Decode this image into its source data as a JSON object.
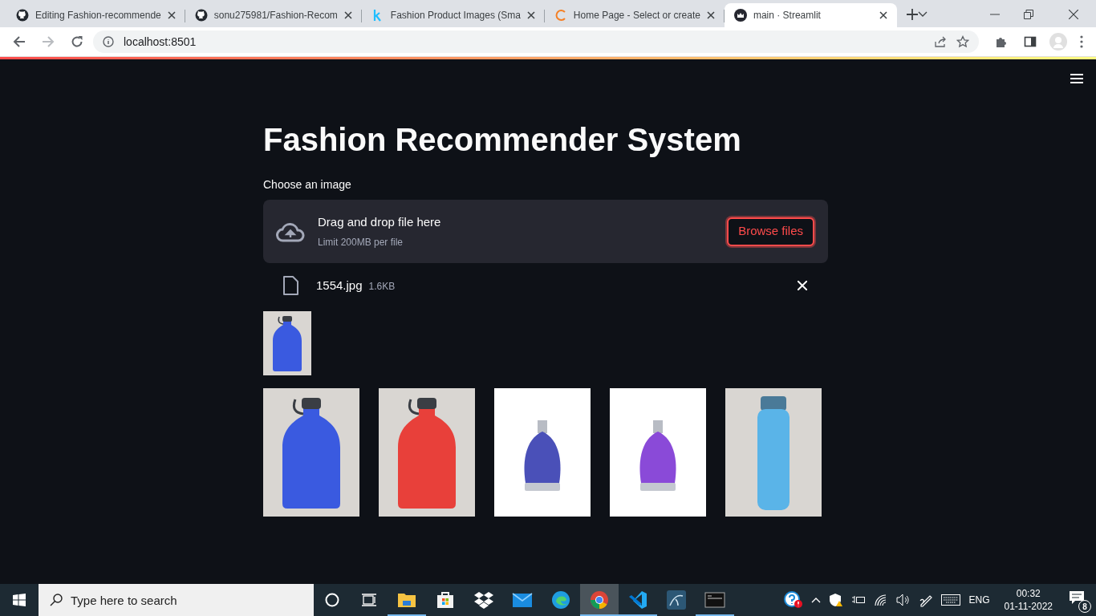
{
  "browser": {
    "tabs": [
      {
        "title": "Editing Fashion-recommende",
        "kind": "github",
        "selected": false
      },
      {
        "title": "sonu275981/Fashion-Recom",
        "kind": "github",
        "selected": false
      },
      {
        "title": "Fashion Product Images (Sma",
        "kind": "kaggle",
        "selected": false
      },
      {
        "title": "Home Page - Select or create",
        "kind": "ring",
        "selected": false
      },
      {
        "title": "main · Streamlit",
        "kind": "crown",
        "selected": true
      }
    ],
    "address": "localhost:8501"
  },
  "app": {
    "title": "Fashion Recommender System",
    "uploader": {
      "label": "Choose an image",
      "prompt": "Drag and drop file here",
      "limit": "Limit 200MB per file",
      "button": "Browse files"
    },
    "file": {
      "name": "1554.jpg",
      "size": "1.6KB"
    },
    "recommendations": [
      {
        "kind": "bottle",
        "color": "#3a5ae0"
      },
      {
        "kind": "bottle",
        "color": "#e8403a"
      },
      {
        "kind": "perfume",
        "color": "#4a50b8"
      },
      {
        "kind": "perfume",
        "color": "#8a4ad8"
      },
      {
        "kind": "slim",
        "color": "#5ab4e8"
      }
    ]
  },
  "taskbar": {
    "search": {
      "placeholder": "Type here to search"
    },
    "apps": [
      {
        "kind": "explorer",
        "running": true,
        "selected": false
      },
      {
        "kind": "store",
        "running": false,
        "selected": false
      },
      {
        "kind": "dropbox",
        "running": false,
        "selected": false
      },
      {
        "kind": "mail",
        "running": false,
        "selected": false
      },
      {
        "kind": "edge",
        "running": false,
        "selected": false
      },
      {
        "kind": "chrome",
        "running": true,
        "selected": true
      },
      {
        "kind": "vscode",
        "running": true,
        "selected": false
      },
      {
        "kind": "workbench",
        "running": false,
        "selected": false
      },
      {
        "kind": "terminal",
        "running": true,
        "selected": false
      }
    ],
    "language": "ENG",
    "time": "00:32",
    "date": "01-11-2022",
    "notifications": "8"
  }
}
